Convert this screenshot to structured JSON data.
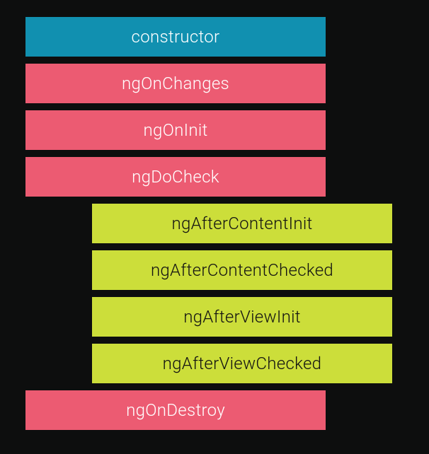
{
  "hooks": {
    "constructor": "constructor",
    "ngOnChanges": "ngOnChanges",
    "ngOnInit": "ngOnInit",
    "ngDoCheck": "ngDoCheck",
    "ngAfterContentInit": "ngAfterContentInit",
    "ngAfterContentChecked": "ngAfterContentChecked",
    "ngAfterViewInit": "ngAfterViewInit",
    "ngAfterViewChecked": "ngAfterViewChecked",
    "ngOnDestroy": "ngOnDestroy"
  },
  "colors": {
    "background": "#0d0e0e",
    "teal": "#1190b0",
    "pink": "#ec5b72",
    "lime": "#ccde3a",
    "tealText": "#ffffff",
    "pinkText": "#ffffff",
    "limeText": "#121212"
  }
}
